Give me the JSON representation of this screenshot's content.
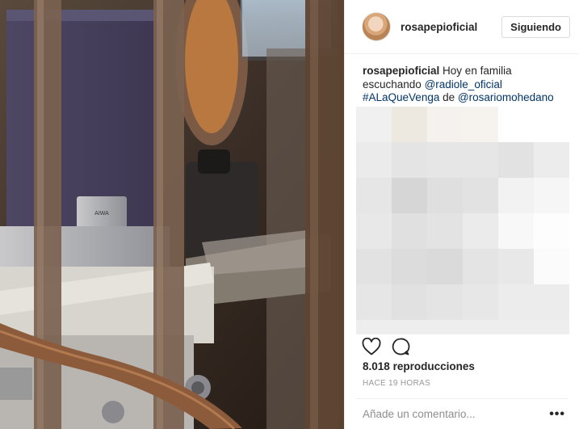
{
  "post": {
    "username": "rosapepioficial",
    "follow_label": "Siguiendo"
  },
  "caption": {
    "author": "rosapepioficial",
    "text_1": "Hoy en familia escuchando",
    "mention_1": "@radiole_oficial",
    "hashtag": "#ALaQueVenga",
    "text_2": "de",
    "mention_2": "@rosariomohedano"
  },
  "stats": {
    "views_count": "8.018",
    "views_label": "reproducciones",
    "timestamp": "HACE 19 HORAS"
  },
  "comment_box": {
    "placeholder": "Añade un comentario..."
  },
  "icons": {
    "like": "heart-icon",
    "comment": "comment-icon",
    "more": "more-options-icon"
  },
  "media": {
    "speaker_brand": "AIWA"
  }
}
